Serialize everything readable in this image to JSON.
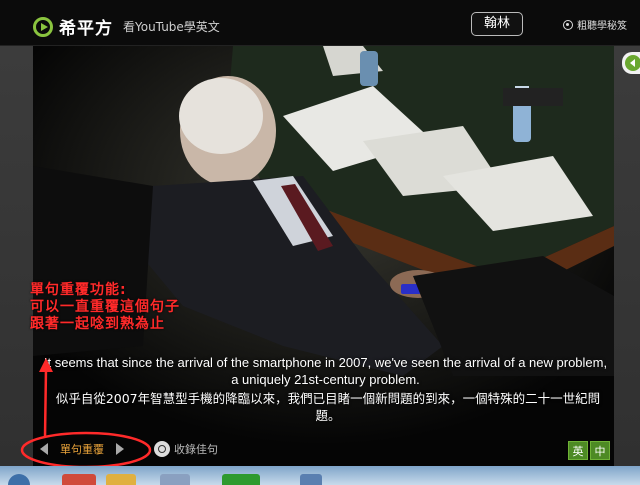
{
  "header": {
    "brand": "希平方",
    "tagline": "看YouTube學英文",
    "user_button": "翰林",
    "secret_link": "粗聽學秘笈"
  },
  "video": {
    "subtitle_en": "It seems that since the arrival of the smartphone in 2007, we've seen the arrival of a new problem, a uniquely 21st-century problem.",
    "subtitle_zh": "似乎自從2007年智慧型手機的降臨以來，我們已目睹一個新問題的到來，一個特殊的二十一世紀問題。"
  },
  "controls": {
    "repeat_label": "單句重覆",
    "collect_label": "收錄佳句",
    "lang_en": "英",
    "lang_zh": "中"
  },
  "annotation": {
    "line1": "單句重覆功能:",
    "line2": "可以一直重覆這個句子",
    "line3": "跟著一起唸到熟為止",
    "color": "#ff2a2a"
  },
  "colors": {
    "accent_green": "#4d8a24",
    "repeat_orange": "#e8a23a"
  }
}
